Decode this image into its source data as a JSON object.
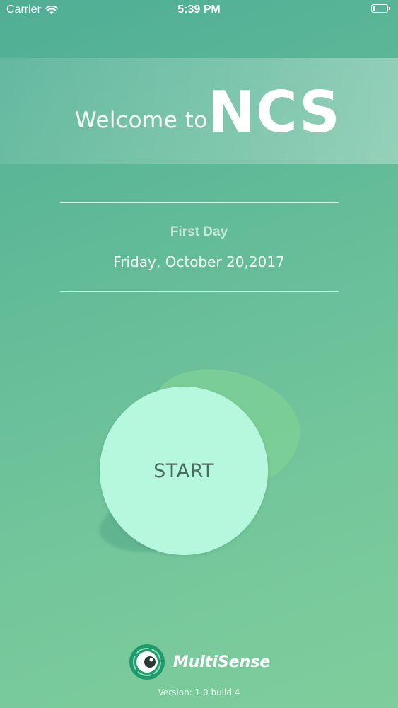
{
  "status_bar": {
    "carrier": "Carrier",
    "time": "5:39 PM",
    "wifi_icon": "wifi-icon",
    "battery_icon": "battery-low-icon",
    "battery_level": 0.2
  },
  "banner": {
    "welcome_text": "Welcome to",
    "app_name": "NCS"
  },
  "day": {
    "label": "First Day",
    "date": "Friday, October 20,2017"
  },
  "start_button": {
    "label": "START"
  },
  "footer": {
    "brand_icon": "multisense-logo-icon",
    "brand_name": "MultiSense",
    "version": "Version: 1.0 build 4"
  },
  "colors": {
    "background_start": "#4fae95",
    "background_end": "#7fcd9c",
    "start_button": "#b6f8dd",
    "start_text": "#4a6b5f",
    "logo_ring": "#1f9a6a"
  }
}
